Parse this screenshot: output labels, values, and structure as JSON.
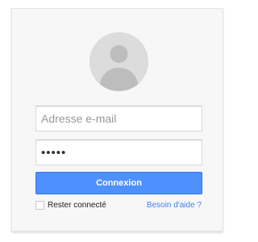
{
  "login": {
    "email_placeholder": "Adresse e-mail",
    "password_value": "•••••",
    "submit_label": "Connexion",
    "remember_label": "Rester connecté",
    "help_label": "Besoin d'aide ?"
  },
  "icons": {
    "avatar": "user-silhouette-icon"
  },
  "colors": {
    "button": "#4d90fe",
    "link": "#427fed",
    "card_background": "#f7f7f7"
  }
}
